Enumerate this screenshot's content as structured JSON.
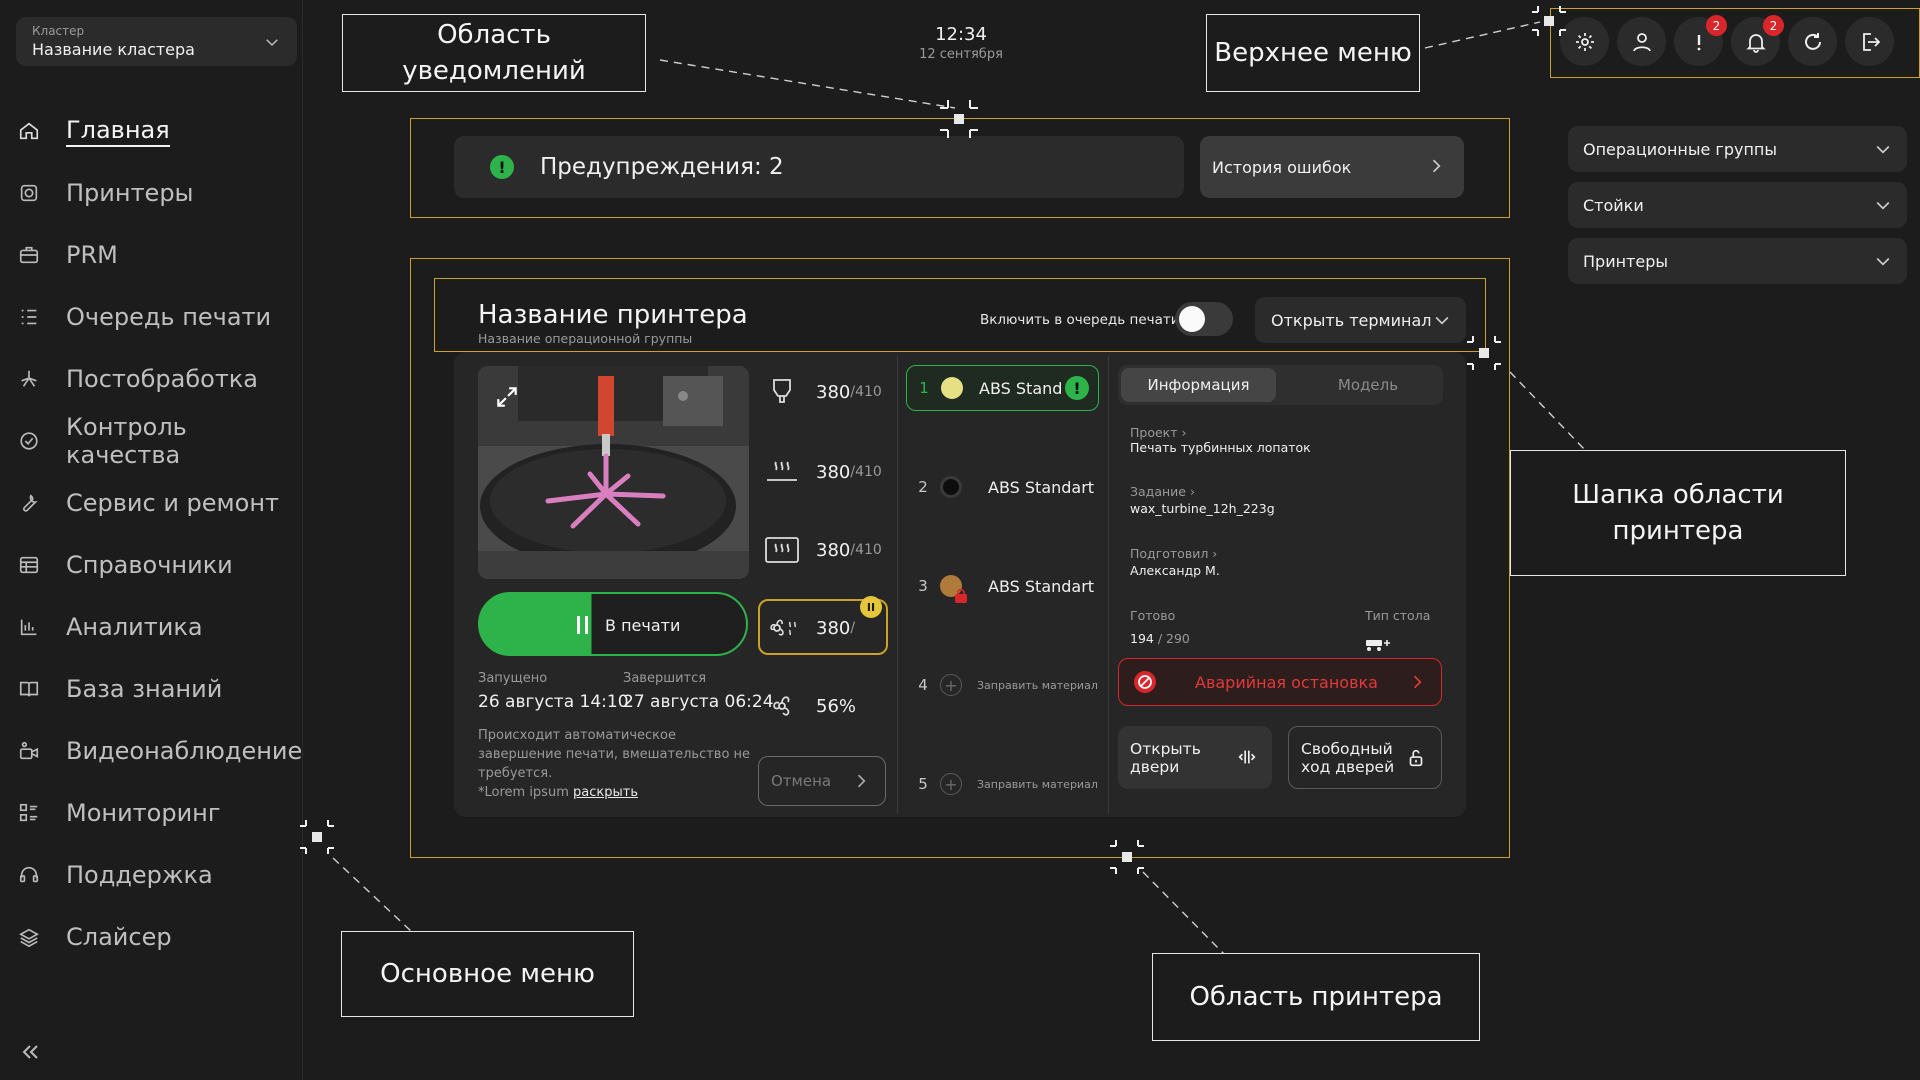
{
  "cluster": {
    "label": "Кластер",
    "value": "Название кластера"
  },
  "clock": {
    "time": "12:34",
    "date": "12 сентября"
  },
  "menu": [
    {
      "label": "Главная",
      "icon": "home-icon",
      "active": true
    },
    {
      "label": "Принтеры",
      "icon": "printer-icon"
    },
    {
      "label": "PRM",
      "icon": "briefcase-icon"
    },
    {
      "label": "Очередь печати",
      "icon": "queue-icon"
    },
    {
      "label": "Постобработка",
      "icon": "postprocess-icon"
    },
    {
      "label": "Контроль качества",
      "icon": "check-circle-icon"
    },
    {
      "label": "Сервис и ремонт",
      "icon": "wrench-icon"
    },
    {
      "label": "Справочники",
      "icon": "table-icon"
    },
    {
      "label": "Аналитика",
      "icon": "bar-chart-icon"
    },
    {
      "label": "База знаний",
      "icon": "book-icon"
    },
    {
      "label": "Видеонаблюдение",
      "icon": "camera-icon"
    },
    {
      "label": "Мониторинг",
      "icon": "grid-list-icon"
    },
    {
      "label": "Поддержка",
      "icon": "headset-icon"
    },
    {
      "label": "Слайсер",
      "icon": "layers-icon"
    }
  ],
  "top_badges": {
    "alerts": "2",
    "notifications": "2"
  },
  "notifications": {
    "warnings": "Предупреждения: 2",
    "warnings_icon": "!",
    "error_history": "История ошибок"
  },
  "filters": [
    "Операционные группы",
    "Стойки",
    "Принтеры"
  ],
  "printer": {
    "name": "Название принтера",
    "group": "Название операционной группы",
    "queue_label": "Включить в очередь печати",
    "queue_enabled": false,
    "terminal": "Открыть терминал",
    "status": "В печати",
    "progress": 0.42,
    "started_label": "Запущено",
    "started": "26 августа 14:10",
    "ends_label": "Завершится",
    "ends": "27 августа 06:24",
    "note": "Происходит автоматическое завершение печати, вмешательство не требуется.",
    "note_more": "*Lorem ipsum",
    "note_link": "раскрыть",
    "cancel": "Отмена",
    "sensors": [
      {
        "icon": "nozzle-icon",
        "value": "380",
        "limit": "/410"
      },
      {
        "icon": "bed-heat-icon",
        "value": "380",
        "limit": "/410"
      },
      {
        "icon": "chamber-heat-icon",
        "value": "380",
        "limit": "/410"
      },
      {
        "icon": "fan-heat-icon",
        "value": "380",
        "limit": "/"
      },
      {
        "icon": "fan-icon",
        "value": "56%",
        "limit": ""
      }
    ],
    "fan_badge": "II",
    "slots": [
      {
        "num": "1",
        "name": "ABS Standart",
        "color": "#e6e085",
        "active": true,
        "badge": "!"
      },
      {
        "num": "2",
        "name": "ABS Standart",
        "color": "#0d0d0d",
        "active": false
      },
      {
        "num": "3",
        "name": "ABS Standart",
        "color": "#b07a3a",
        "active": false,
        "locked": true
      },
      {
        "num": "4",
        "name": "Заправить материал",
        "empty": true
      },
      {
        "num": "5",
        "name": "Заправить материал",
        "empty": true
      }
    ],
    "tabs": [
      "Информация",
      "Модель"
    ],
    "info": {
      "project_label": "Проект",
      "project": "Печать турбинных лопаток",
      "task_label": "Задание",
      "task": "wax_turbine_12h_223g",
      "prepared_label": "Подготовил",
      "prepared": "Александр М.",
      "ready_label": "Готово",
      "ready_done": "194",
      "ready_total": "290",
      "table_label": "Тип стола"
    },
    "estop": "Аварийная остановка",
    "open_doors": "Открыть двери",
    "free_doors": "Свободный ход дверей"
  },
  "annotations": {
    "notifications": "Область уведомлений",
    "top_menu": "Верхнее меню",
    "printer_header": "Шапка области принтера",
    "main_menu": "Основное меню",
    "printer_area": "Область принтера"
  },
  "colors": {
    "accent_green": "#2eb34a",
    "accent_yellow": "#c9a227",
    "danger": "#d9262b",
    "panel": "#2b2b2b"
  }
}
